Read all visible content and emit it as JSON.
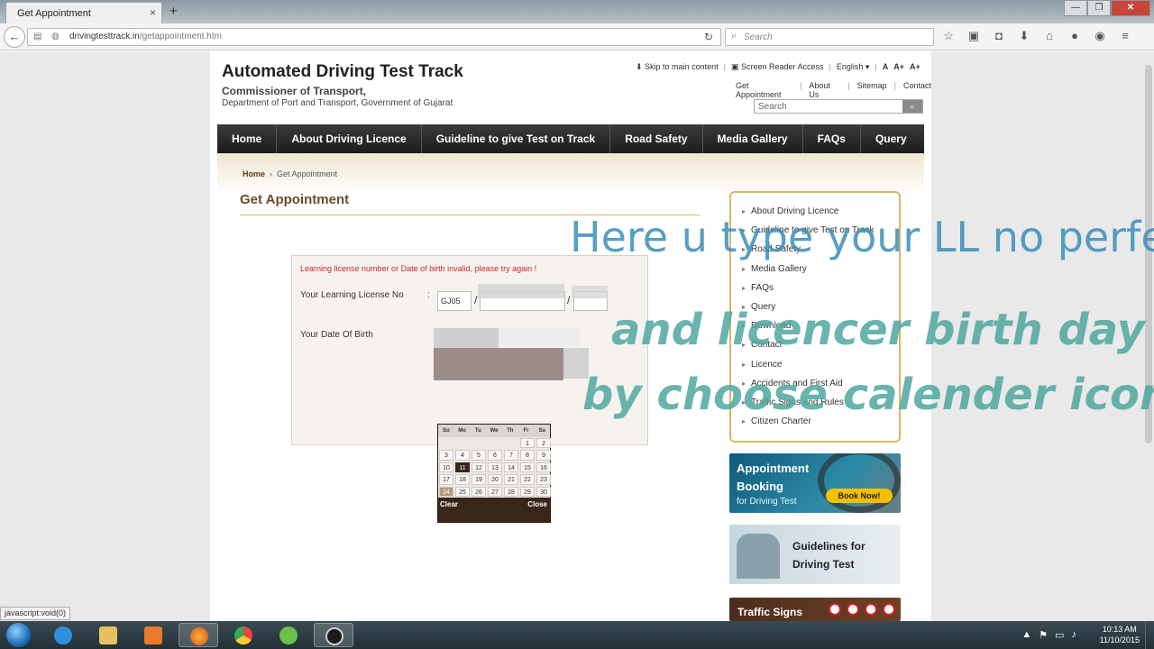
{
  "browser": {
    "tab_title": "Get Appointment",
    "tab_close": "×",
    "new_tab": "+",
    "url_domain": "drivingtesttrack.in",
    "url_path": "/getappointment.htm",
    "search_placeholder": "Search",
    "status_tip": "javascript:void(0)"
  },
  "header": {
    "title": "Automated Driving Test Track",
    "subtitle": "Commissioner of Transport,",
    "department": "Department of Port and Transport, Government of Gujarat",
    "skip_link": "Skip to main content",
    "screen_reader": "Screen Reader Access",
    "language": "English",
    "font_small": "A",
    "font_medium": "A+",
    "font_large": "A+",
    "links": [
      "Get Appointment",
      "About Us",
      "Sitemap",
      "Contact"
    ],
    "search_placeholder": "Search"
  },
  "nav": [
    "Home",
    "About Driving Licence",
    "Guideline to give Test on Track",
    "Road Safety",
    "Media Gallery",
    "FAQs",
    "Query"
  ],
  "breadcrumb": {
    "home": "Home",
    "sep": "›",
    "current": "Get Appointment"
  },
  "page_heading": "Get Appointment",
  "form": {
    "error": "Learning license number or Date of birth invalid, please try again !",
    "label_ll": "Your Learning License No",
    "colon": ":",
    "ll_prefix": "GJ05",
    "slash": "/",
    "label_dob": "Your Date Of Birth"
  },
  "calendar": {
    "weekdays": [
      "Su",
      "Mo",
      "Tu",
      "We",
      "Th",
      "Fr",
      "Sa"
    ],
    "rows": [
      [
        "",
        "",
        "",
        "",
        "",
        "1",
        "2"
      ],
      [
        "3",
        "4",
        "5",
        "6",
        "7",
        "8",
        "9"
      ],
      [
        "10",
        "11",
        "12",
        "13",
        "14",
        "15",
        "16"
      ],
      [
        "17",
        "18",
        "19",
        "20",
        "21",
        "22",
        "23"
      ],
      [
        "24",
        "25",
        "26",
        "27",
        "28",
        "29",
        "30"
      ]
    ],
    "today": "11",
    "clear": "Clear",
    "close": "Close"
  },
  "sidebar": {
    "items": [
      "About Driving Licence",
      "Guideline to give Test on Track",
      "Road Safety",
      "Media Gallery",
      "FAQs",
      "Query",
      "Download",
      "Contact",
      "Licence",
      "Accidents and First Aid",
      "Traffic Signs and Rules",
      "Citizen Charter"
    ]
  },
  "banners": {
    "appointment_line1": "Appointment",
    "appointment_line2": "Booking",
    "appointment_line3": "for Driving Test",
    "book_now": "Book Now!",
    "guidelines_line1": "Guidelines for",
    "guidelines_line2": "Driving Test",
    "traffic": "Traffic Signs"
  },
  "overlay": {
    "line1": "Here u type your LL no perfect",
    "line2": "and licencer birth day",
    "line3": "by choose calender icon"
  },
  "taskbar": {
    "time": "10:13 AM",
    "date": "11/10/2015"
  },
  "colors": {
    "nav_bg": "#2b2b2b",
    "accent_gold": "#d9b760",
    "error_red": "#c0282c",
    "heading_brown": "#6b4a2a"
  }
}
